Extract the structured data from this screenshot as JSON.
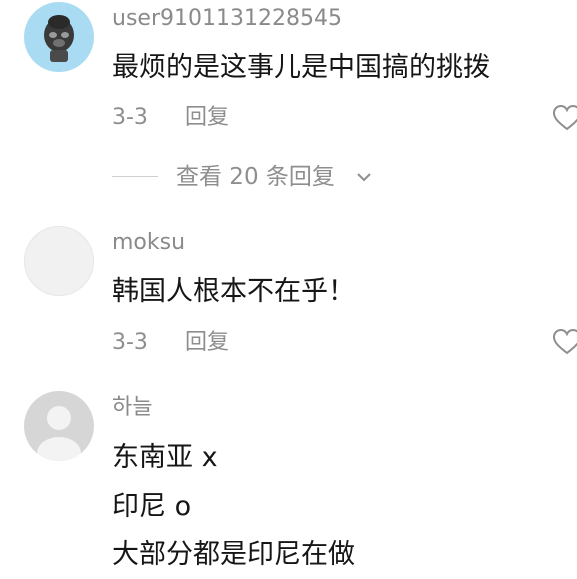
{
  "comments": [
    {
      "username": "user9101131228545",
      "lines": [
        "最烦的是这事儿是中国搞的挑拨"
      ],
      "date": "3-3",
      "reply_label": "回复",
      "avatar_icon": "dark-monkey-avatar-icon"
    },
    {
      "username": "moksu",
      "lines": [
        "韩国人根本不在乎！"
      ],
      "date": "3-3",
      "reply_label": "回复",
      "avatar_icon": "blank-avatar-icon"
    },
    {
      "username": "하늘",
      "lines": [
        "东南亚 x",
        "印尼 o",
        "大部分都是印尼在做"
      ],
      "avatar_icon": "default-user-avatar-icon"
    }
  ],
  "view_replies": {
    "label": "查看 20 条回复"
  },
  "colors": {
    "text_primary": "#161616",
    "text_secondary": "#8e8e8e",
    "avatar_blue": "#a9dcf3"
  }
}
